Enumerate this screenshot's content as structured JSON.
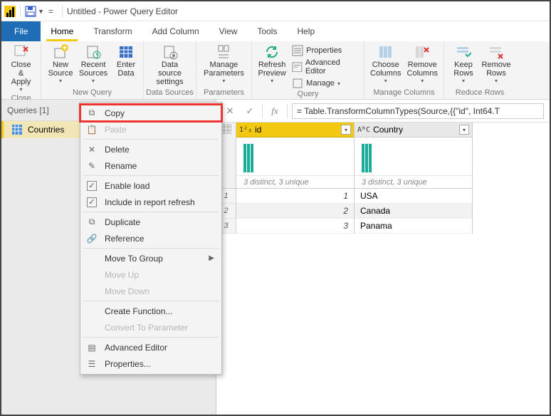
{
  "titlebar": {
    "title": "Untitled - Power Query Editor"
  },
  "menus": {
    "file": "File",
    "home": "Home",
    "transform": "Transform",
    "addcolumn": "Add Column",
    "view": "View",
    "tools": "Tools",
    "help": "Help"
  },
  "ribbon": {
    "close": {
      "label": "Close &\nApply",
      "group": "Close"
    },
    "newquery": {
      "new": "New\nSource",
      "recent": "Recent\nSources",
      "enter": "Enter\nData",
      "group": "New Query"
    },
    "datasources": {
      "settings": "Data source\nsettings",
      "group": "Data Sources"
    },
    "parameters": {
      "manage": "Manage\nParameters",
      "group": "Parameters"
    },
    "query": {
      "refresh": "Refresh\nPreview",
      "properties": "Properties",
      "adveditor": "Advanced Editor",
      "manage": "Manage",
      "group": "Query"
    },
    "managecols": {
      "choose": "Choose\nColumns",
      "remove": "Remove\nColumns",
      "group": "Manage Columns"
    },
    "reducerows": {
      "keep": "Keep\nRows",
      "remove": "Remove\nRows",
      "group": "Reduce Rows"
    }
  },
  "queriespanel": {
    "header": "Queries [1]",
    "items": [
      {
        "name": "Countries"
      }
    ]
  },
  "context_menu": {
    "copy": "Copy",
    "paste": "Paste",
    "delete": "Delete",
    "rename": "Rename",
    "enableload": "Enable load",
    "includerefresh": "Include in report refresh",
    "duplicate": "Duplicate",
    "reference": "Reference",
    "movegroup": "Move To Group",
    "moveup": "Move Up",
    "movedown": "Move Down",
    "createfn": "Create Function...",
    "toparam": "Convert To Parameter",
    "adveditor": "Advanced Editor",
    "properties": "Properties..."
  },
  "formula": "= Table.TransformColumnTypes(Source,{{\"id\", Int64.T",
  "columns": [
    {
      "type": "1²₃",
      "name": "id",
      "stats": "3 distinct, 3 unique"
    },
    {
      "type": "AᴮC",
      "name": "Country",
      "stats": "3 distinct, 3 unique"
    }
  ],
  "rows": [
    {
      "n": "1",
      "id": "1",
      "country": "USA"
    },
    {
      "n": "2",
      "id": "2",
      "country": "Canada"
    },
    {
      "n": "3",
      "id": "3",
      "country": "Panama"
    }
  ],
  "chart_data": {
    "type": "table",
    "title": "Countries",
    "columns": [
      "id",
      "Country"
    ],
    "rows": [
      [
        1,
        "USA"
      ],
      [
        2,
        "Canada"
      ],
      [
        3,
        "Panama"
      ]
    ],
    "column_profiling": [
      {
        "column": "id",
        "distinct": 3,
        "unique": 3
      },
      {
        "column": "Country",
        "distinct": 3,
        "unique": 3
      }
    ]
  }
}
